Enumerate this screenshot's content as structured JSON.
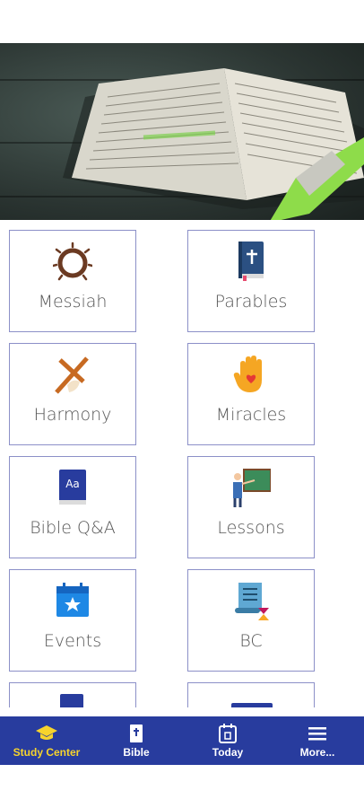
{
  "tiles": [
    {
      "label": "Messiah",
      "icon": "crown-of-thorns-icon"
    },
    {
      "label": "Parables",
      "icon": "bible-book-icon"
    },
    {
      "label": "Harmony",
      "icon": "cross-icon"
    },
    {
      "label": "Miracles",
      "icon": "hand-heart-icon"
    },
    {
      "label": "Bible Q&A",
      "icon": "dictionary-book-icon"
    },
    {
      "label": "Lessons",
      "icon": "teacher-board-icon"
    },
    {
      "label": "Events",
      "icon": "calendar-star-icon"
    },
    {
      "label": "BC",
      "icon": "scroll-hourglass-icon"
    }
  ],
  "nav": [
    {
      "label": "Study Center",
      "icon": "graduation-cap-icon",
      "active": true
    },
    {
      "label": "Bible",
      "icon": "bible-icon",
      "active": false
    },
    {
      "label": "Today",
      "icon": "calendar-icon",
      "active": false
    },
    {
      "label": "More...",
      "icon": "menu-icon",
      "active": false
    }
  ],
  "colors": {
    "nav_bg": "#283c9e",
    "nav_active": "#f7d42c",
    "tile_border": "#8c90c8"
  }
}
